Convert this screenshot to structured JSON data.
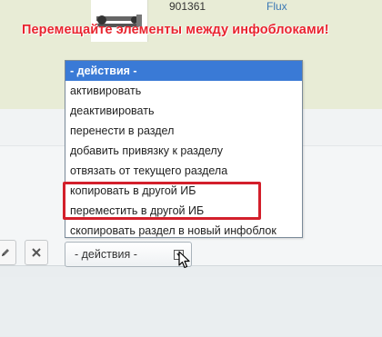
{
  "product": {
    "id": "901361",
    "brand": "Flux"
  },
  "banner": {
    "text": "Перемещайте элементы между инфоблоками!",
    "color": "#e8252f"
  },
  "toolbar": {
    "edit_icon": "pencil-icon",
    "delete_icon": "close-icon"
  },
  "actions_select": {
    "selected": "- действия -",
    "options": [
      "- действия -",
      "активировать",
      "деактивировать",
      "перенести в раздел",
      "добавить привязку к разделу",
      "отвязать от текущего раздела",
      "копировать в другой ИБ",
      "переместить в другой ИБ",
      "скопировать раздел в новый инфоблок"
    ],
    "highlighted_color": "#d31f2b",
    "selected_color": "#3a7ad6"
  }
}
